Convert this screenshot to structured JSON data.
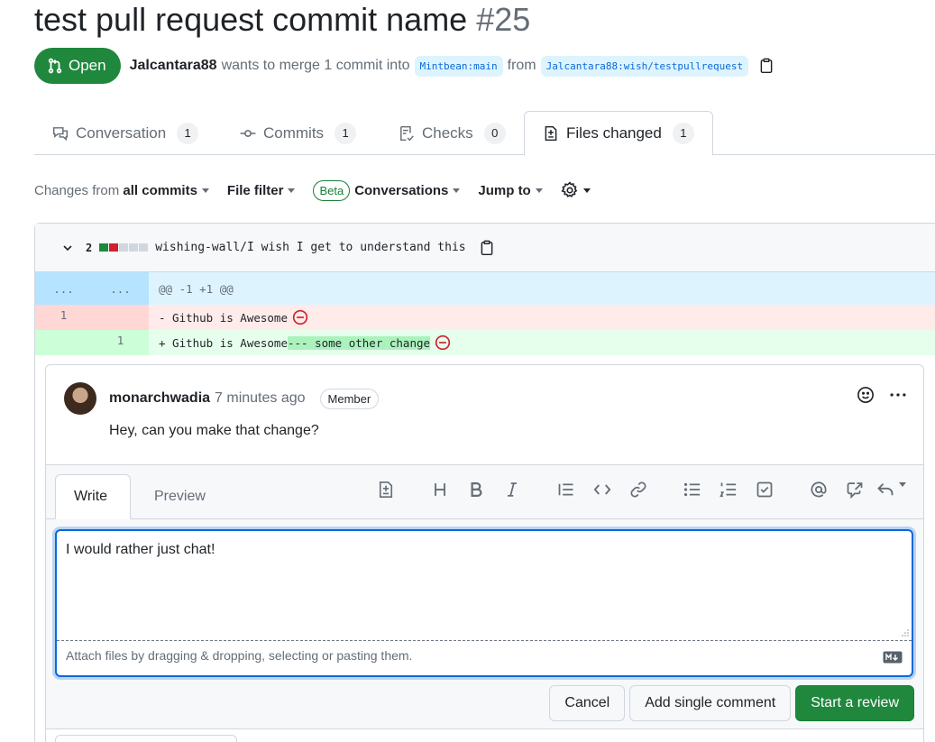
{
  "pr": {
    "title": "test pull request commit name",
    "number": "#25",
    "state": "Open",
    "author": "Jalcantara88",
    "merge_text": "wants to merge 1 commit into",
    "base_branch": "Mintbean:main",
    "from_text": "from",
    "head_branch": "Jalcantara88:wish/testpullrequest"
  },
  "tabs": [
    {
      "label": "Conversation",
      "count": "1"
    },
    {
      "label": "Commits",
      "count": "1"
    },
    {
      "label": "Checks",
      "count": "0"
    },
    {
      "label": "Files changed",
      "count": "1"
    }
  ],
  "toolbar": {
    "changes_prefix": "Changes from",
    "changes_value": "all commits",
    "file_filter": "File filter",
    "beta": "Beta",
    "conversations": "Conversations",
    "jump_to": "Jump to"
  },
  "file": {
    "change_count": "2",
    "path": "wishing-wall/I wish I get to understand this",
    "hunk_left": "...",
    "hunk_right": "...",
    "hunk_header": "@@ -1 +1 @@",
    "del_line_no": "1",
    "del_code": "- Github is Awesome",
    "add_line_no": "1",
    "add_code": "+ Github is Awesome",
    "add_highlight": "--- some other change"
  },
  "comment": {
    "author": "monarchwadia",
    "time": "7 minutes ago",
    "role": "Member",
    "body": "Hey, can you make that change?"
  },
  "editor": {
    "write_tab": "Write",
    "preview_tab": "Preview",
    "value": "I would rather just chat!",
    "attach_hint": "Attach files by dragging & dropping, selecting or pasting them."
  },
  "buttons": {
    "cancel": "Cancel",
    "add_single": "Add single comment",
    "start_review": "Start a review"
  },
  "colors": {
    "green": "#1f883d",
    "blue": "#0969da",
    "del_bg": "#ffebe9",
    "add_bg": "#e6ffec"
  }
}
